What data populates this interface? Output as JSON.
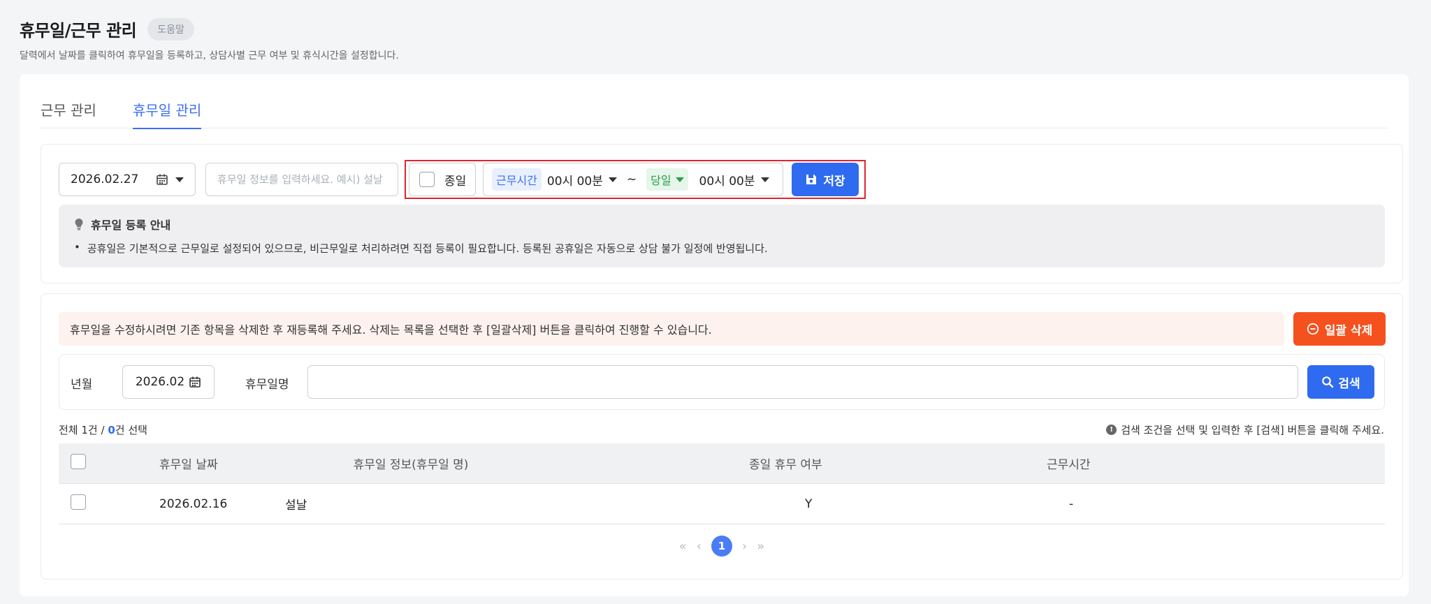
{
  "header": {
    "title": "휴무일/근무 관리",
    "help_label": "도움말",
    "description": "달력에서 날짜를 클릭하여 휴무일을 등록하고, 상담사별 근무 여부 및 휴식시간을 설정합니다."
  },
  "tabs": [
    {
      "label": "근무 관리",
      "active": false
    },
    {
      "label": "휴무일 관리",
      "active": true
    }
  ],
  "register": {
    "date_value": "2026.02.27",
    "info_placeholder": "휴무일 정보를 입력하세요. 예시) 설날",
    "allday_label": "종일",
    "worktime_chip": "근무시간",
    "start_time": "00시 00분",
    "tilde": "~",
    "day_chip": "당일",
    "end_time": "00시 00분",
    "save_label": "저장"
  },
  "notice": {
    "title": "휴무일 등록 안내",
    "bullet": "•",
    "text": "공휴일은 기본적으로 근무일로 설정되어 있으므로, 비근무일로 처리하려면 직접 등록이 필요합니다. 등록된 공휴일은 자동으로 상담 불가 일정에 반영됩니다."
  },
  "list": {
    "warning": "휴무일을 수정하시려면 기존 항목을 삭제한 후 재등록해 주세요. 삭제는 목록을 선택한 후 [일괄삭제] 버튼을 클릭하여 진행할 수 있습니다.",
    "bulk_delete_label": "일괄 삭제",
    "search": {
      "ym_label": "년월",
      "ym_value": "2026.02",
      "name_label": "휴무일명",
      "name_value": "",
      "search_label": "검색"
    },
    "count_prefix": "전체 1건 / ",
    "count_selected": "0",
    "count_suffix": "건 선택",
    "hint": "검색 조건을 선택 및 입력한 후 [검색] 버튼을 클릭해 주세요.",
    "columns": [
      "휴무일 날짜",
      "휴무일 정보(휴무일 명)",
      "종일 휴무 여부",
      "근무시간"
    ],
    "rows": [
      {
        "date": "2026.02.16",
        "info": "설날",
        "allday": "Y",
        "time": "-"
      }
    ],
    "pagination": {
      "first": "«",
      "prev": "‹",
      "current": "1",
      "next": "›",
      "last": "»"
    }
  },
  "colors": {
    "accent": "#2f6bf0",
    "danger": "#f4511e",
    "highlight_border": "#e0242e",
    "green_chip": "#27a046"
  }
}
